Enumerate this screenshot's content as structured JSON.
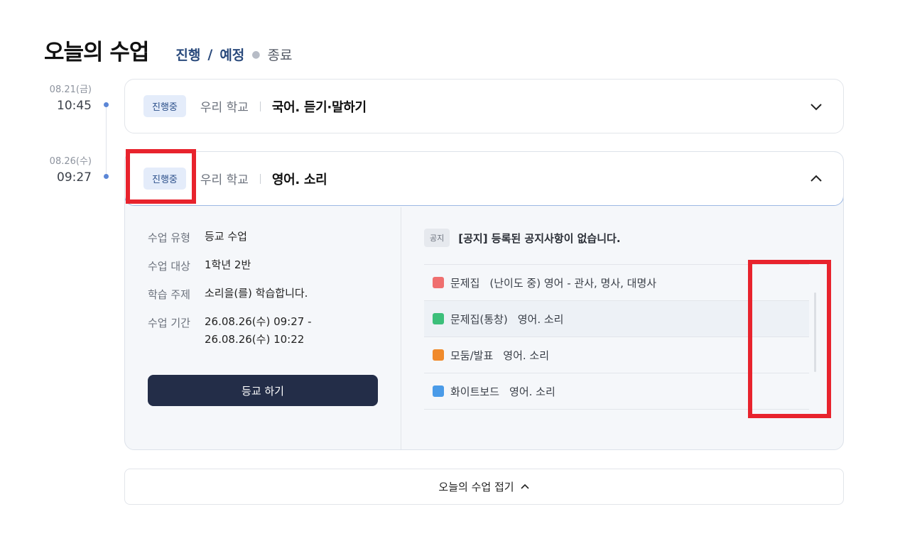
{
  "header": {
    "title": "오늘의 수업",
    "filter_active": "진행",
    "filter_sep": "/",
    "filter_active2": "예정",
    "filter_inactive": "종료"
  },
  "lessons": [
    {
      "date": "08.21(금)",
      "time": "10:45",
      "status": "진행중",
      "school": "우리 학교",
      "title": "국어. 듣기·말하기"
    },
    {
      "date": "08.26(수)",
      "time": "09:27",
      "status": "진행중",
      "school": "우리 학교",
      "title": "영어. 소리"
    }
  ],
  "detail": {
    "type_label": "수업 유형",
    "type_value": "등교 수업",
    "target_label": "수업 대상",
    "target_value": "1학년 2반",
    "topic_label": "학습 주제",
    "topic_value": "소리을(를) 학습합니다.",
    "period_label": "수업 기간",
    "period_start": "26.08.26(수) 09:27 -",
    "period_end": "26.08.26(수) 10:22",
    "go_button": "등교 하기"
  },
  "notice": {
    "tag": "공지",
    "text": "[공지] 등록된 공지사항이 없습니다."
  },
  "materials": [
    {
      "type": "문제집",
      "title": "(난이도 중) 영어 - 관사, 명사, 대명사",
      "icon": "workbook-icon",
      "color": "#ef6f6f"
    },
    {
      "type": "문제집(통창)",
      "title": "영어. 소리",
      "icon": "workbook-icon",
      "color": "#3cbf7a"
    },
    {
      "type": "모둠/발표",
      "title": "영어. 소리",
      "icon": "group-icon",
      "color": "#f08a2b"
    },
    {
      "type": "화이트보드",
      "title": "영어. 소리",
      "icon": "whiteboard-icon",
      "color": "#4a9be8"
    }
  ],
  "footer": {
    "collapse_label": "오늘의 수업 접기"
  },
  "colors": {
    "accent": "#2a4a7c",
    "button_dark": "#232d48",
    "badge_bg": "#e4ecfa",
    "highlight": "#e8232d"
  }
}
